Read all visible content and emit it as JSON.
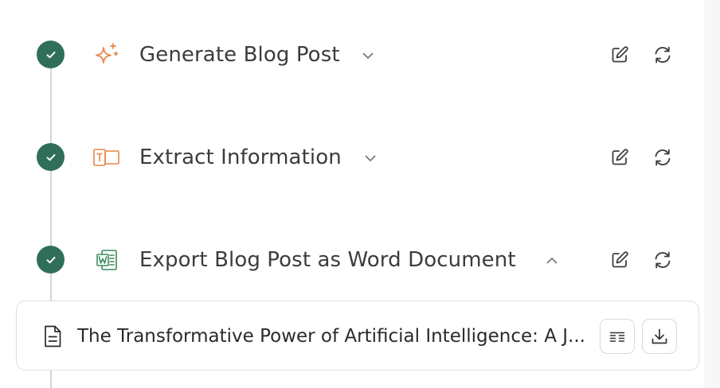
{
  "steps": [
    {
      "title": "Generate Blog Post",
      "icon": "sparkle-icon",
      "status": "completed",
      "expanded": false,
      "icon_color": "#e8874a"
    },
    {
      "title": "Extract Information",
      "icon": "extract-text-icon",
      "status": "completed",
      "expanded": false,
      "icon_color": "#e8874a"
    },
    {
      "title": "Export Blog Post as Word Document",
      "icon": "word-document-icon",
      "status": "completed",
      "expanded": true,
      "icon_color": "#3f8a5f"
    }
  ],
  "output_file": {
    "name": "The Transformative Power of Artificial Intelligence: A J...",
    "icon": "document-icon"
  },
  "actions": {
    "edit_icon": "edit-icon",
    "rerun_icon": "refresh-icon",
    "view_icon": "list-view-icon",
    "download_icon": "download-icon"
  },
  "colors": {
    "check_green": "#2f6f59",
    "title_text": "#3c3c3c",
    "timeline": "#d4d4d4",
    "card_border": "#dedede"
  }
}
